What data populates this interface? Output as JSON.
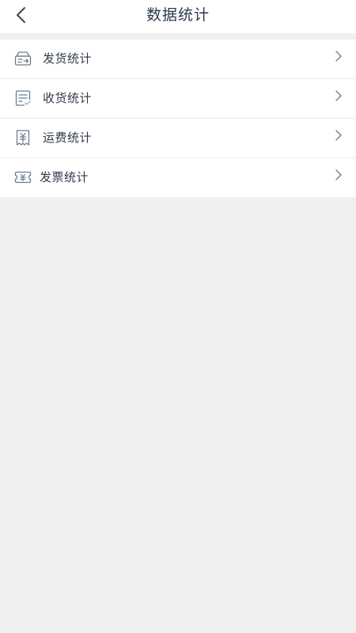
{
  "header": {
    "title": "数据统计",
    "back_icon": "chevron-left-icon"
  },
  "menu": {
    "items": [
      {
        "label": "发货统计",
        "icon": "shipment-out-icon"
      },
      {
        "label": "收货统计",
        "icon": "receipt-check-icon"
      },
      {
        "label": "运费统计",
        "icon": "freight-yuan-icon"
      },
      {
        "label": "发票统计",
        "icon": "invoice-icon"
      }
    ]
  },
  "colors": {
    "title": "#2d3a4b",
    "label": "#2f3a4a",
    "icon": "#6b7d90",
    "background": "#f0f0f0"
  }
}
